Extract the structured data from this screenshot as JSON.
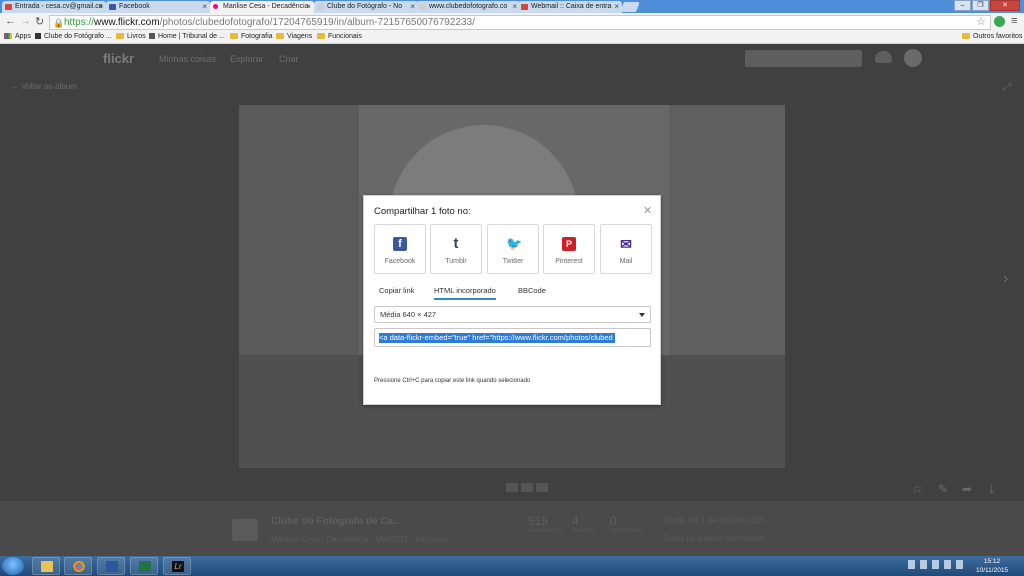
{
  "browser": {
    "tabs": [
      {
        "title": "Entrada - cesa.cv@gmail.co",
        "favicon_color": "#d44638",
        "favicon_name": "gmail-icon"
      },
      {
        "title": "Facebook",
        "favicon_color": "#3b5998",
        "favicon_name": "facebook-icon"
      },
      {
        "title": "Marilise Cesa - Decadência",
        "favicon_color": "#ff0084",
        "favicon_name": "flickr-icon"
      },
      {
        "title": "Clube do Fotógrafo - No",
        "favicon_color": "#999999",
        "favicon_name": "page-icon"
      },
      {
        "title": "www.clubedofotografo.co",
        "favicon_color": "#999999",
        "favicon_name": "page-icon"
      },
      {
        "title": "Webmail :: Caixa de entra",
        "favicon_color": "#d44638",
        "favicon_name": "webmail-icon"
      }
    ],
    "url": {
      "scheme": "https://",
      "host": "www.flickr.com",
      "path": "/photos/clubedofotografo/17204765919/in/album-72157650076792233/"
    },
    "bookmarks": [
      {
        "label": "Apps",
        "icon": "apps-grid-icon"
      },
      {
        "label": "Clube do Fotógrafo ...",
        "icon": "bookmark-icon"
      },
      {
        "label": "Livros",
        "icon": "folder-icon"
      },
      {
        "label": "Home | Tribunal de ...",
        "icon": "bookmark-icon"
      },
      {
        "label": "Fotografia",
        "icon": "folder-icon"
      },
      {
        "label": "Viagens",
        "icon": "folder-icon"
      },
      {
        "label": "Funcionais",
        "icon": "folder-icon"
      }
    ],
    "other_bookmarks": "Outros favoritos"
  },
  "flickr": {
    "logo": "flickr",
    "nav": [
      "Minhas coisas",
      "Explorar",
      "Criar"
    ],
    "back_link": "Voltar ao álbum",
    "info": {
      "album_title": "Clube do Fotógrafo de Ca...",
      "photo_title": "Marilise Cesa - Decadência - Mai/2015 - impresso",
      "stats": [
        {
          "value": "515",
          "label": "visualizações"
        },
        {
          "value": "4",
          "label": "favoritos"
        },
        {
          "value": "0",
          "label": "comentários"
        }
      ],
      "taken": "Tirada em 1 de abril de 2015",
      "rights": "Todos os direitos reservados"
    }
  },
  "share_modal": {
    "title": "Compartilhar 1 foto no:",
    "services": [
      {
        "label": "Facebook",
        "glyph": "f"
      },
      {
        "label": "Tumblr",
        "glyph": "t"
      },
      {
        "label": "Twitter",
        "glyph": "🐦"
      },
      {
        "label": "Pinterest",
        "glyph": "P"
      },
      {
        "label": "Mail",
        "glyph": "✉"
      }
    ],
    "tabs": [
      "Copiar link",
      "HTML incorporado",
      "BBCode"
    ],
    "active_tab": "HTML incorporado",
    "size_option": "Média 640 × 427",
    "embed_code": "<a data-flickr-embed=\"true\"  href=\"https://www.flickr.com/photos/clubed",
    "hint": "Pressione Ctrl+C para copiar este link quando selecionado"
  },
  "taskbar": {
    "time": "15:12",
    "date": "10/11/2015"
  }
}
